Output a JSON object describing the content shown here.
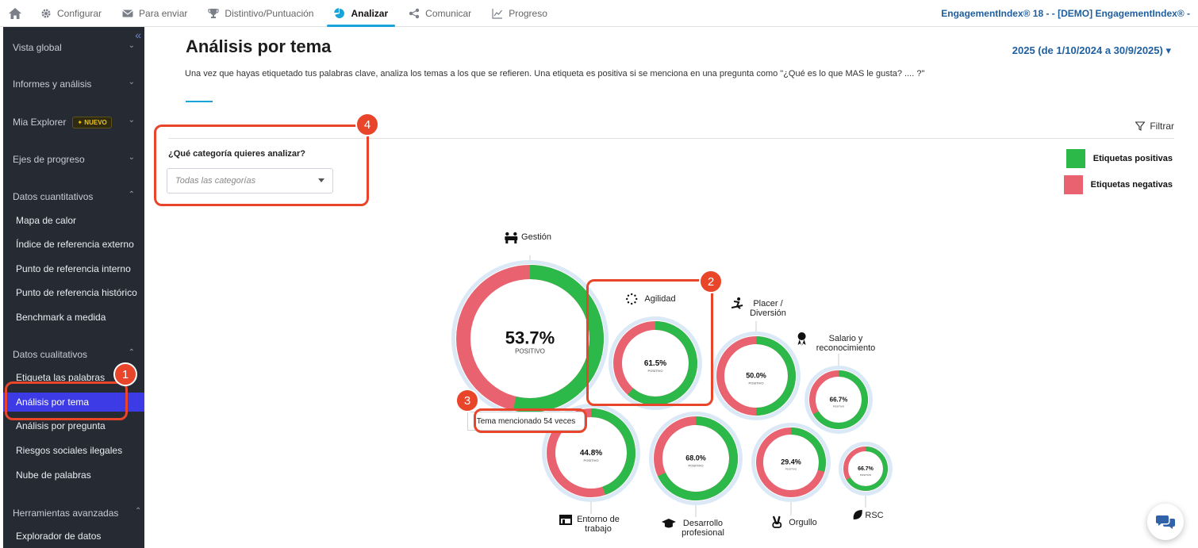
{
  "nav": {
    "home_icon": "home-icon",
    "items": [
      {
        "label": "Configurar",
        "icon": "gear-icon"
      },
      {
        "label": "Para enviar",
        "icon": "envelope-icon"
      },
      {
        "label": "Distintivo/Puntuación",
        "icon": "trophy-icon"
      },
      {
        "label": "Analizar",
        "icon": "pie-chart-icon",
        "active": true
      },
      {
        "label": "Comunicar",
        "icon": "share-icon"
      },
      {
        "label": "Progreso",
        "icon": "line-chart-icon"
      }
    ],
    "survey_title": "EngagementIndex® 18 - - [DEMO] EngagementIndex® -"
  },
  "sidebar": {
    "sections": [
      {
        "label": "Vista global"
      },
      {
        "label": "Informes y análisis"
      },
      {
        "label": "Mia Explorer",
        "badge": "NUEVO"
      },
      {
        "label": "Ejes de progreso"
      },
      {
        "label": "Datos cuantitativos"
      },
      {
        "label": "Datos cualitativos"
      },
      {
        "label": "Herramientas avanzadas"
      }
    ],
    "quant_items": [
      "Mapa de calor",
      "Índice de referencia externo",
      "Punto de referencia interno",
      "Punto de referencia histórico",
      "Benchmark a medida"
    ],
    "qual_items": [
      "Etiqueta las palabras",
      "Análisis por tema",
      "Análisis por pregunta",
      "Riesgos sociales ilegales",
      "Nube de palabras"
    ],
    "adv_items": [
      "Explorador de datos"
    ]
  },
  "main": {
    "title": "Análisis por tema",
    "period": "2025 (de 1/10/2024 a 30/9/2025)",
    "description": "Una vez que hayas etiquetado tus palabras clave, analiza los temas a los que se refieren. Una etiqueta es positiva si se menciona en una pregunta como \"¿Qué es lo que MAS le gusta? .... ?\"",
    "filter_label": "Filtrar",
    "category_question": "¿Qué categoría quieres analizar?",
    "category_placeholder": "Todas las categorías",
    "legend": {
      "positive": "Etiquetas positivas",
      "negative": "Etiquetas negativas"
    },
    "tooltip": "Tema mencionado 54 veces"
  },
  "colors": {
    "positive": "#2db84a",
    "negative": "#e8636f",
    "halo": "#dbe9f7",
    "accent": "#1aa3d9",
    "annotation": "#e8452a"
  },
  "themes": [
    {
      "name": "Gestión",
      "name_lines": [
        "Gestión"
      ],
      "positive": 53.7,
      "label": "53.7%",
      "sub": "POSITIVO",
      "icon": "people-icon"
    },
    {
      "name": "Agilidad",
      "name_lines": [
        "Agilidad"
      ],
      "positive": 61.5,
      "label": "61.5%",
      "sub": "POSITIVO",
      "icon": "spinner-icon"
    },
    {
      "name": "Placer / Diversión",
      "name_lines": [
        "Placer /",
        "Diversión"
      ],
      "positive": 50.0,
      "label": "50.0%",
      "sub": "POSITIVO",
      "icon": "snowboard-icon"
    },
    {
      "name": "Salario y reconocimiento",
      "name_lines": [
        "Salario y",
        "reconocimiento"
      ],
      "positive": 66.7,
      "label": "66.7%",
      "sub": "POSITIVO",
      "icon": "award-icon"
    },
    {
      "name": "Entorno de trabajo",
      "name_lines": [
        "Entorno de",
        "trabajo"
      ],
      "positive": 44.8,
      "label": "44.8%",
      "sub": "POSITIVO",
      "icon": "storefront-icon"
    },
    {
      "name": "Desarrollo profesional",
      "name_lines": [
        "Desarrollo",
        "profesional"
      ],
      "positive": 68.0,
      "label": "68.0%",
      "sub": "POSITIVO",
      "icon": "graduation-cap-icon"
    },
    {
      "name": "Orgullo",
      "name_lines": [
        "Orgullo"
      ],
      "positive": 29.4,
      "label": "29.4%",
      "sub": "POSITIVO",
      "icon": "victory-hand-icon"
    },
    {
      "name": "RSC",
      "name_lines": [
        "RSC"
      ],
      "positive": 66.7,
      "label": "66.7%",
      "sub": "POSITIVO",
      "icon": "leaf-icon"
    }
  ],
  "annotations": [
    "1",
    "2",
    "3",
    "4"
  ]
}
